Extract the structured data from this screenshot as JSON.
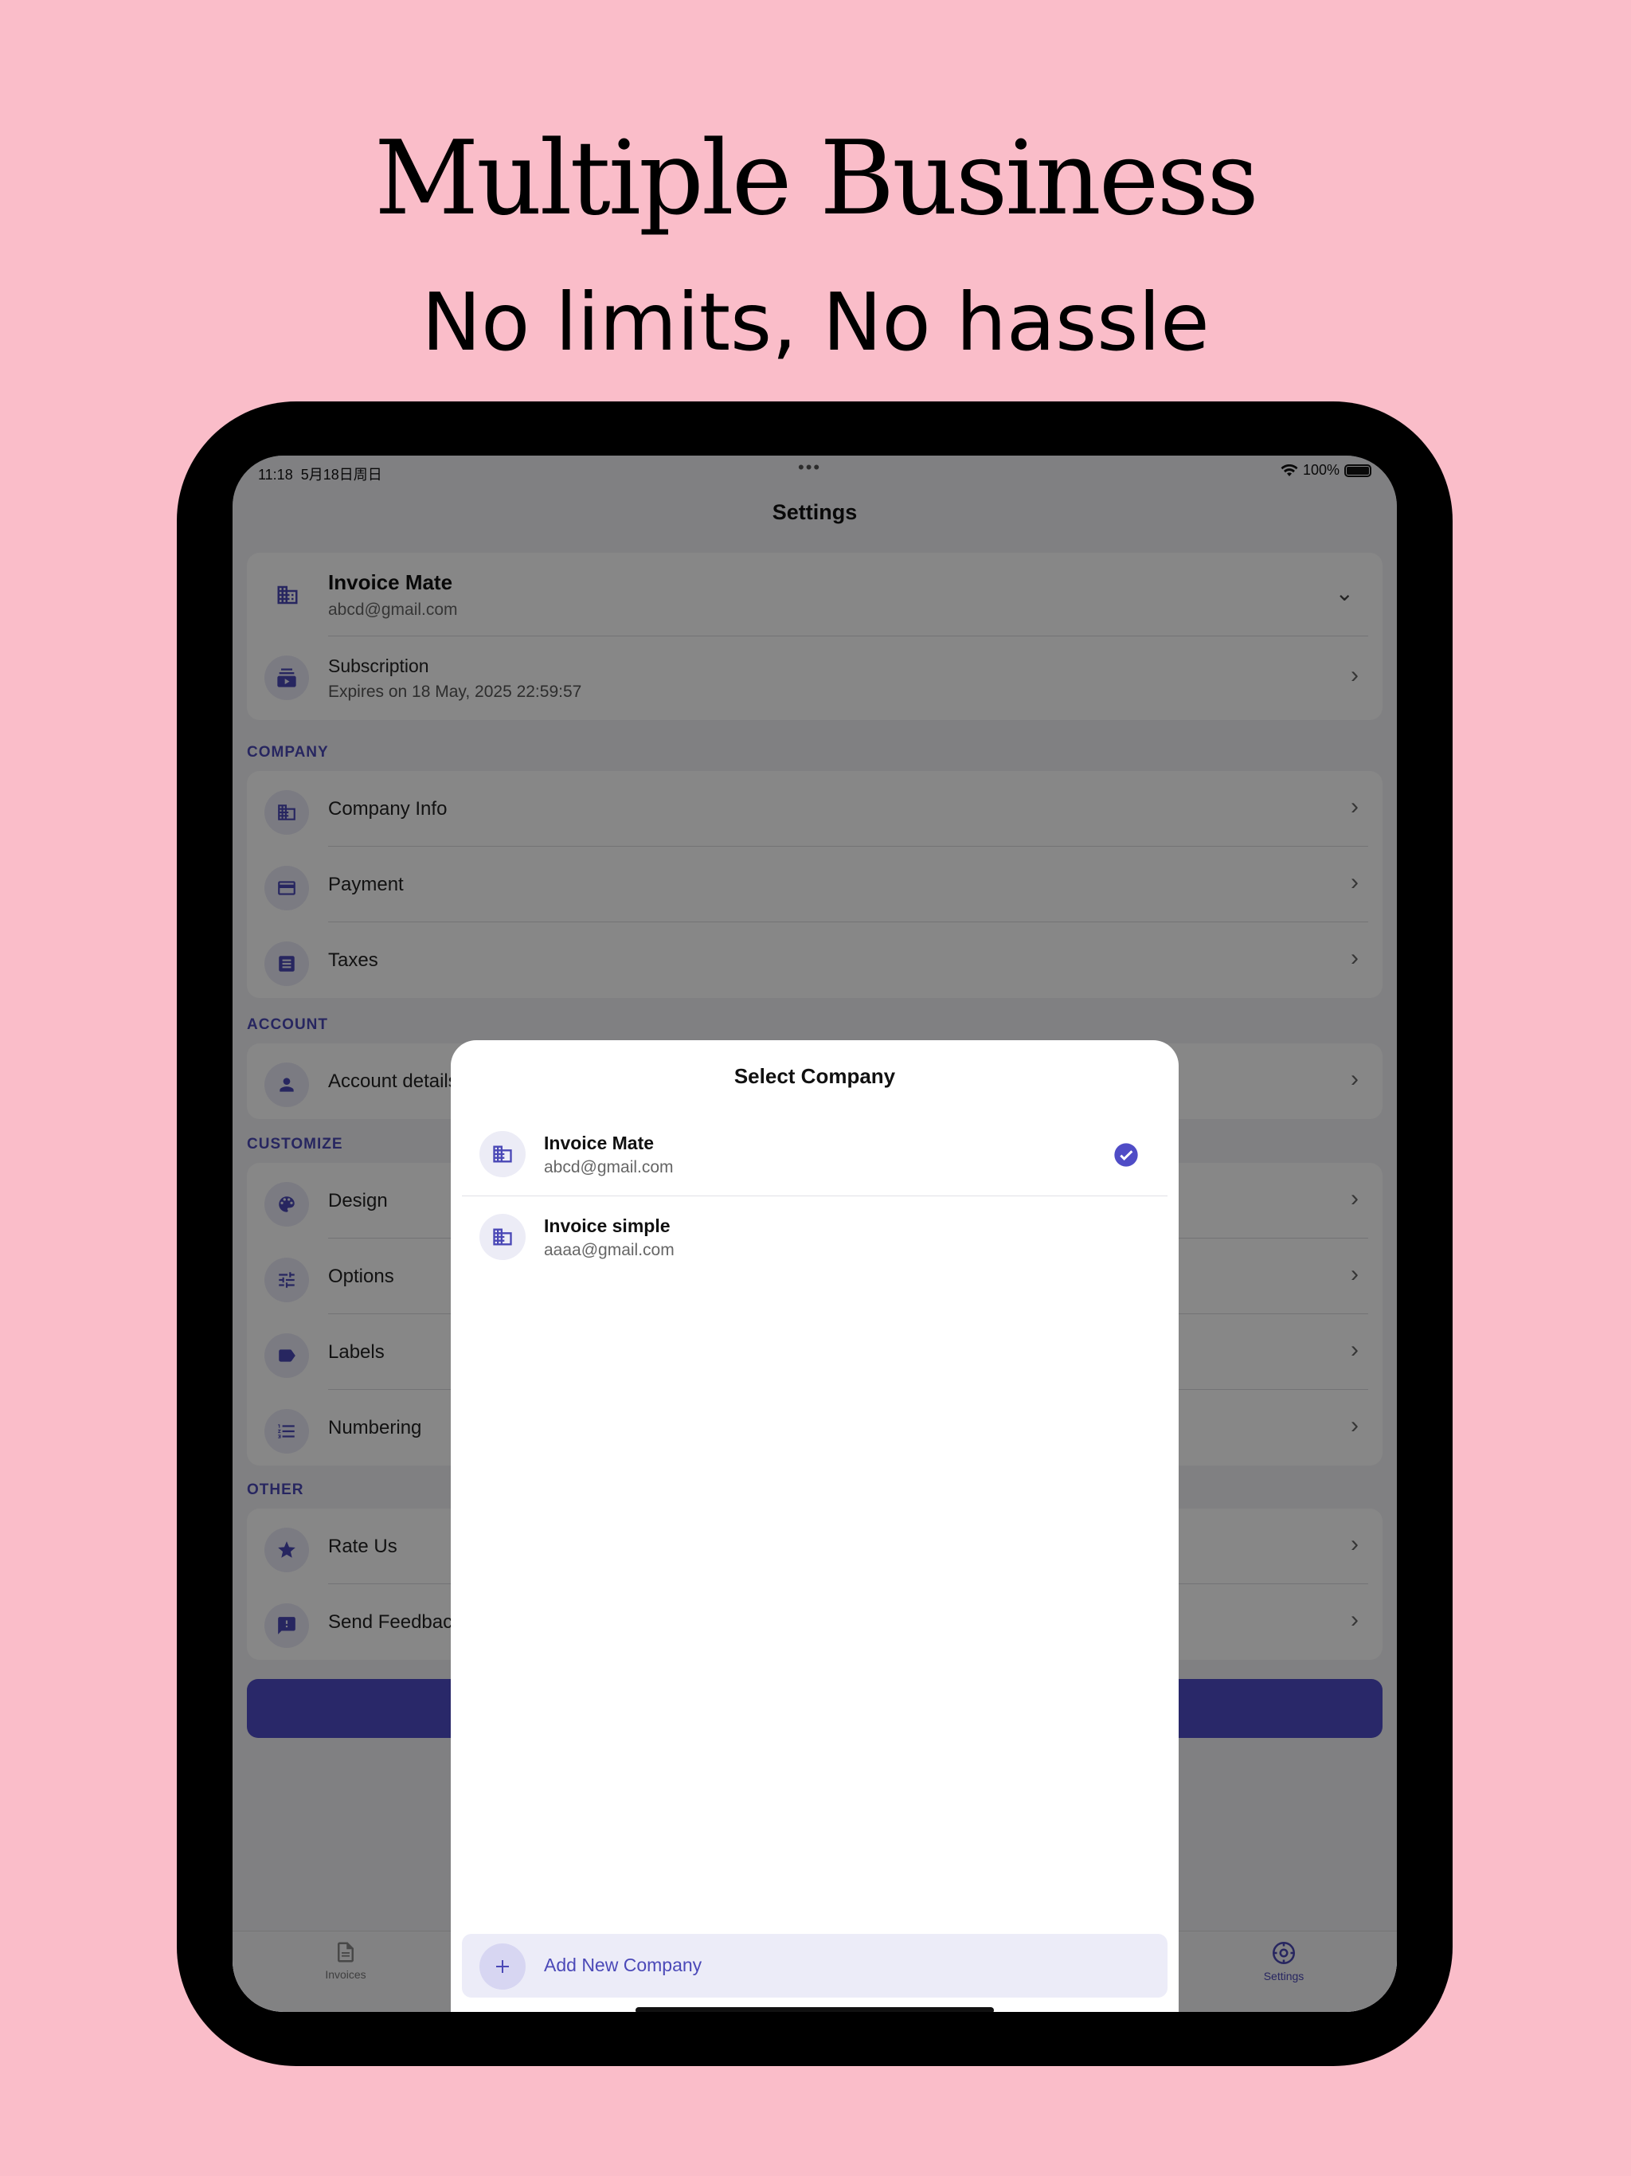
{
  "headline": {
    "title": "Multiple Business",
    "subtitle": "No limits, No hassle"
  },
  "status_bar": {
    "time": "11:18",
    "date": "5月18日周日",
    "battery": "100%"
  },
  "settings": {
    "title": "Settings",
    "current_company": {
      "name": "Invoice Mate",
      "email": "abcd@gmail.com"
    },
    "subscription": {
      "label": "Subscription",
      "detail": "Expires on 18 May, 2025 22:59:57"
    },
    "sections": {
      "company": {
        "label": "COMPANY",
        "items": [
          "Company Info",
          "Payment",
          "Taxes"
        ]
      },
      "account": {
        "label": "ACCOUNT",
        "items": [
          "Account details"
        ]
      },
      "customize": {
        "label": "CUSTOMIZE",
        "items": [
          "Design",
          "Options",
          "Labels",
          "Numbering"
        ]
      },
      "other": {
        "label": "OTHER",
        "items": [
          "Rate Us",
          "Send Feedback"
        ]
      }
    }
  },
  "tabbar": {
    "invoices": "Invoices",
    "settings": "Settings"
  },
  "sheet": {
    "title": "Select Company",
    "companies": [
      {
        "name": "Invoice Mate",
        "email": "abcd@gmail.com",
        "selected": true
      },
      {
        "name": "Invoice simple",
        "email": "aaaa@gmail.com",
        "selected": false
      }
    ],
    "add_label": "Add New Company"
  },
  "colors": {
    "accent": "#4a48b6",
    "background": "#fabdc9"
  }
}
